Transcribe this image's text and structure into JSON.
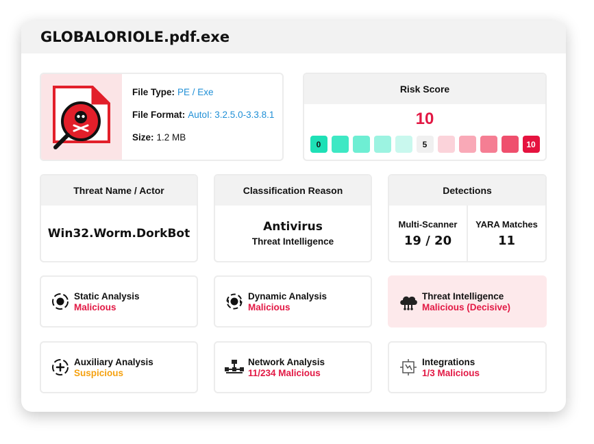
{
  "file": {
    "name": "GLOBALORIOLE.pdf.exe",
    "type_label": "File Type:",
    "type_value": "PE / Exe",
    "format_label": "File Format:",
    "format_value": "AutoI: 3.2.5.0-3.3.8.1",
    "size_label": "Size:",
    "size_value": "1.2 MB",
    "thumbnail_icon": "malware-file-magnifier-icon"
  },
  "risk": {
    "title": "Risk Score",
    "score": "10",
    "scale": [
      {
        "label": "0",
        "color": "#1ee0b6",
        "text_color": "#111111",
        "shown": true
      },
      {
        "label": "",
        "color": "#3ee8c4",
        "shown": false
      },
      {
        "label": "",
        "color": "#6eeed3",
        "shown": false
      },
      {
        "label": "",
        "color": "#9cf3e1",
        "shown": false
      },
      {
        "label": "",
        "color": "#c9f8ee",
        "shown": false
      },
      {
        "label": "5",
        "color": "#f0f0f0",
        "text_color": "#111111",
        "shown": true
      },
      {
        "label": "",
        "color": "#fbd3da",
        "shown": false
      },
      {
        "label": "",
        "color": "#f9a9b7",
        "shown": false
      },
      {
        "label": "",
        "color": "#f57e93",
        "shown": false
      },
      {
        "label": "",
        "color": "#ef4f6d",
        "shown": false
      },
      {
        "label": "10",
        "color": "#e5133f",
        "text_color": "#ffffff",
        "shown": true
      }
    ]
  },
  "threat": {
    "title": "Threat Name / Actor",
    "name": "Win32.Worm.DorkBot"
  },
  "classification": {
    "title": "Classification Reason",
    "main": "Antivirus",
    "sub": "Threat Intelligence"
  },
  "detections": {
    "title": "Detections",
    "multi_scanner_label": "Multi-Scanner",
    "multi_scanner_value": "19 / 20",
    "yara_label": "YARA Matches",
    "yara_value": "11"
  },
  "analyses": [
    {
      "title": "Static Analysis",
      "status": "Malicious",
      "status_color": "#e21844",
      "icon": "static-analysis-icon"
    },
    {
      "title": "Dynamic Analysis",
      "status": "Malicious",
      "status_color": "#e21844",
      "icon": "dynamic-analysis-icon"
    },
    {
      "title": "Threat Intelligence",
      "status": "Malicious (Decisive)",
      "status_color": "#e21844",
      "icon": "threat-intelligence-icon"
    },
    {
      "title": "Auxiliary Analysis",
      "status": "Suspicious",
      "status_color": "#f5a10f",
      "icon": "auxiliary-analysis-icon"
    },
    {
      "title": "Network Analysis",
      "status": "11/234 Malicious",
      "status_color": "#e21844",
      "icon": "network-analysis-icon"
    },
    {
      "title": "Integrations",
      "status": "1/3 Malicious",
      "status_color": "#e21844",
      "icon": "integrations-icon"
    }
  ],
  "colors": {
    "malicious": "#e21844",
    "suspicious": "#f5a10f",
    "link": "#1f8fd6",
    "highlight_bg": "#fde9eb"
  }
}
